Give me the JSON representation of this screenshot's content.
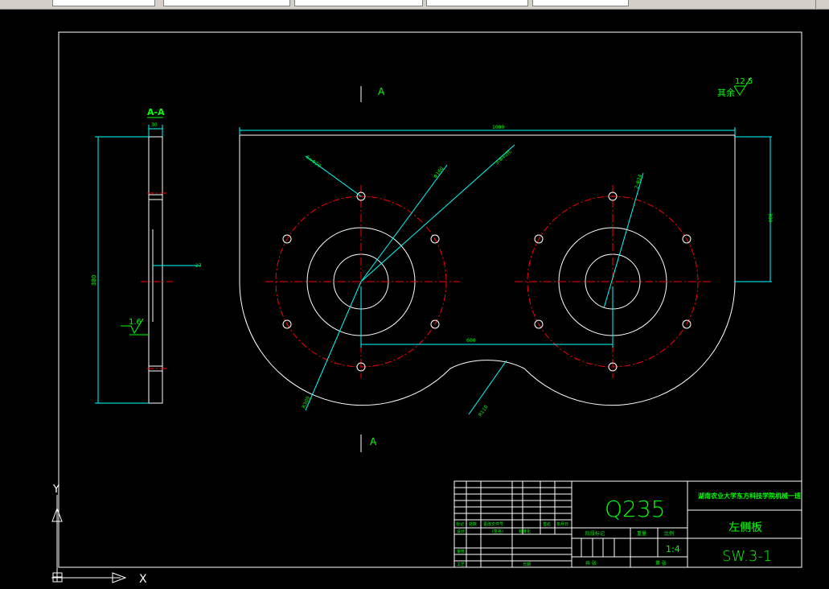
{
  "toolbar": {
    "fields": [
      "",
      "",
      "",
      "",
      "",
      ""
    ]
  },
  "drawing": {
    "section_mark": "A",
    "section_title": "A-A",
    "roughness_note": "其余",
    "roughness_value": "12.5",
    "side_roughness": "1.6",
    "dims": {
      "side_thickness": "30",
      "side_height": "380",
      "side_offset": "27",
      "overall_width": "1080",
      "right_height": "380",
      "center_spacing": "600",
      "bolt_circle_left": "6×Φ20",
      "hole_dia": "Φ160",
      "through_holes": "3-Φ40孔",
      "bolt_circle_right": "2-Φ24",
      "arc_radius_left": "R300",
      "neck_radius": "R110"
    }
  },
  "title_block": {
    "material": "Q235",
    "school": "湖南农业大学东方科技学院机械一班",
    "part_name": "左侧板",
    "drawing_no": "SW.3-1",
    "scale": "1:4",
    "row_labels": [
      "标记",
      "处数",
      "分区",
      "更改文件号",
      "签名",
      "年月日"
    ],
    "sign_labels": [
      "设计",
      "(签名)",
      "(年月日)",
      "标准化"
    ],
    "check_labels": [
      "审核",
      "工艺",
      "日期"
    ],
    "stage_label": "阶段标记",
    "weight_label": "重量",
    "scale_label": "比例",
    "sheets_label": "共 张",
    "sheet_label": "第 张"
  },
  "ucs": {
    "x_label": "X",
    "y_label": "Y"
  },
  "colors": {
    "background": "#000000",
    "outline": "#ffffff",
    "dimension": "#00ffff",
    "centerline": "#ff0000",
    "text": "#00ff00"
  }
}
